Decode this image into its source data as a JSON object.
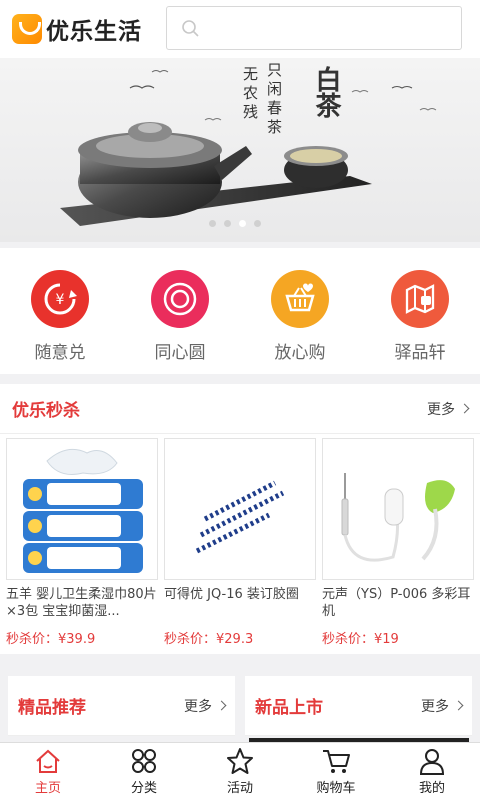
{
  "header": {
    "logo_text": "优乐生活",
    "search_placeholder": ""
  },
  "banner": {
    "title_big": "白茶",
    "poem_col1": "只闲春茶",
    "poem_col2": "无农残",
    "slides": 4,
    "active_slide": 3
  },
  "quick_entries": [
    {
      "label": "随意兑",
      "icon": "exchange-icon",
      "color": "#e8322c"
    },
    {
      "label": "同心圆",
      "icon": "concentric-circle-icon",
      "color": "#ea2d5c"
    },
    {
      "label": "放心购",
      "icon": "basket-icon",
      "color": "#f5a623"
    },
    {
      "label": "驿品轩",
      "icon": "store-icon",
      "color": "#ef5a3c"
    }
  ],
  "flash_sale": {
    "title": "优乐秒杀",
    "more": "更多",
    "products": [
      {
        "name": "五羊 婴儿卫生柔湿巾80片×3包 宝宝抑菌湿...",
        "price": "秒杀价：¥39.9"
      },
      {
        "name": "可得优 JQ-16 装订胶圈",
        "price": "秒杀价：¥29.3"
      },
      {
        "name": "元声（YS）P-006 多彩耳机",
        "price": "秒杀价：¥19"
      }
    ]
  },
  "panels": [
    {
      "title": "精品推荐",
      "more": "更多"
    },
    {
      "title": "新品上市",
      "more": "更多"
    }
  ],
  "tabbar": {
    "active": "主页",
    "items": [
      {
        "label": "主页",
        "icon": "home-icon"
      },
      {
        "label": "分类",
        "icon": "category-icon"
      },
      {
        "label": "活动",
        "icon": "star-icon"
      },
      {
        "label": "购物车",
        "icon": "cart-icon"
      },
      {
        "label": "我的",
        "icon": "user-icon"
      }
    ]
  },
  "colors": {
    "accent": "#e33b3b",
    "brand_orange": "#ff9a0a"
  }
}
